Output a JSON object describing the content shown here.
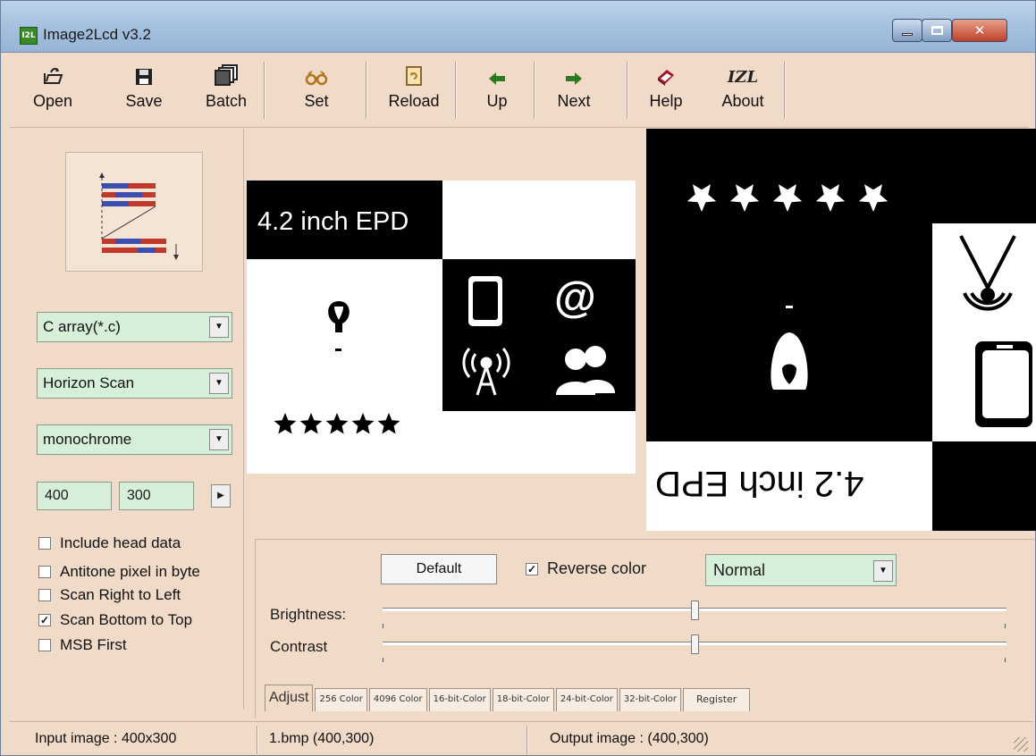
{
  "window": {
    "title": "Image2Lcd v3.2",
    "icon_text": "I2L"
  },
  "toolbar": {
    "buttons": [
      {
        "label": "Open",
        "icon": "open-folder-icon"
      },
      {
        "label": "Save",
        "icon": "floppy-disk-icon"
      },
      {
        "label": "Batch",
        "icon": "batch-icon"
      },
      {
        "label": "Set",
        "icon": "glasses-icon"
      },
      {
        "label": "Reload",
        "icon": "reload-icon"
      },
      {
        "label": "Up",
        "icon": "left-arrow-icon"
      },
      {
        "label": "Next",
        "icon": "right-arrow-icon"
      },
      {
        "label": "Help",
        "icon": "help-book-icon"
      },
      {
        "label": "About",
        "icon": "izl-logo-icon"
      }
    ],
    "about_glyph": "IZL"
  },
  "left_panel": {
    "output_type": "C array(*.c)",
    "scan_mode": "Horizon Scan",
    "color_depth": "monochrome",
    "width": "400",
    "height": "300",
    "options": [
      {
        "label": "Include head data",
        "checked": false
      },
      {
        "label": "Antitone pixel in byte",
        "checked": false
      },
      {
        "label": "Scan Right to Left",
        "checked": false
      },
      {
        "label": "Scan Bottom to Top",
        "checked": true
      },
      {
        "label": "MSB First",
        "checked": false
      }
    ]
  },
  "preview": {
    "input_title": "4.2 inch EPD",
    "output_title": "4.2 inch EPD",
    "stars": "★★★★★",
    "at_symbol": "@"
  },
  "adjust": {
    "default_label": "Default",
    "reverse_label": "Reverse color",
    "reverse_checked": true,
    "mode_value": "Normal",
    "brightness_label": "Brightness:",
    "contrast_label": "Contrast",
    "brightness_level": 0.5,
    "contrast_level": 0.5,
    "tabs": [
      "Adjust",
      "256 Color",
      "4096 Color",
      "16-bit-Color",
      "18-bit-Color",
      "24-bit-Color",
      "32-bit-Color",
      "Register"
    ],
    "active_tab": "Adjust"
  },
  "status": {
    "input": "Input image : 400x300",
    "file": "1.bmp (400,300)",
    "output": "Output image : (400,300)"
  },
  "colors": {
    "window_bg": "#f0dac8",
    "field_bg": "#d6efd8",
    "titlebar": "#a7c2e0",
    "close": "#c1412a"
  }
}
